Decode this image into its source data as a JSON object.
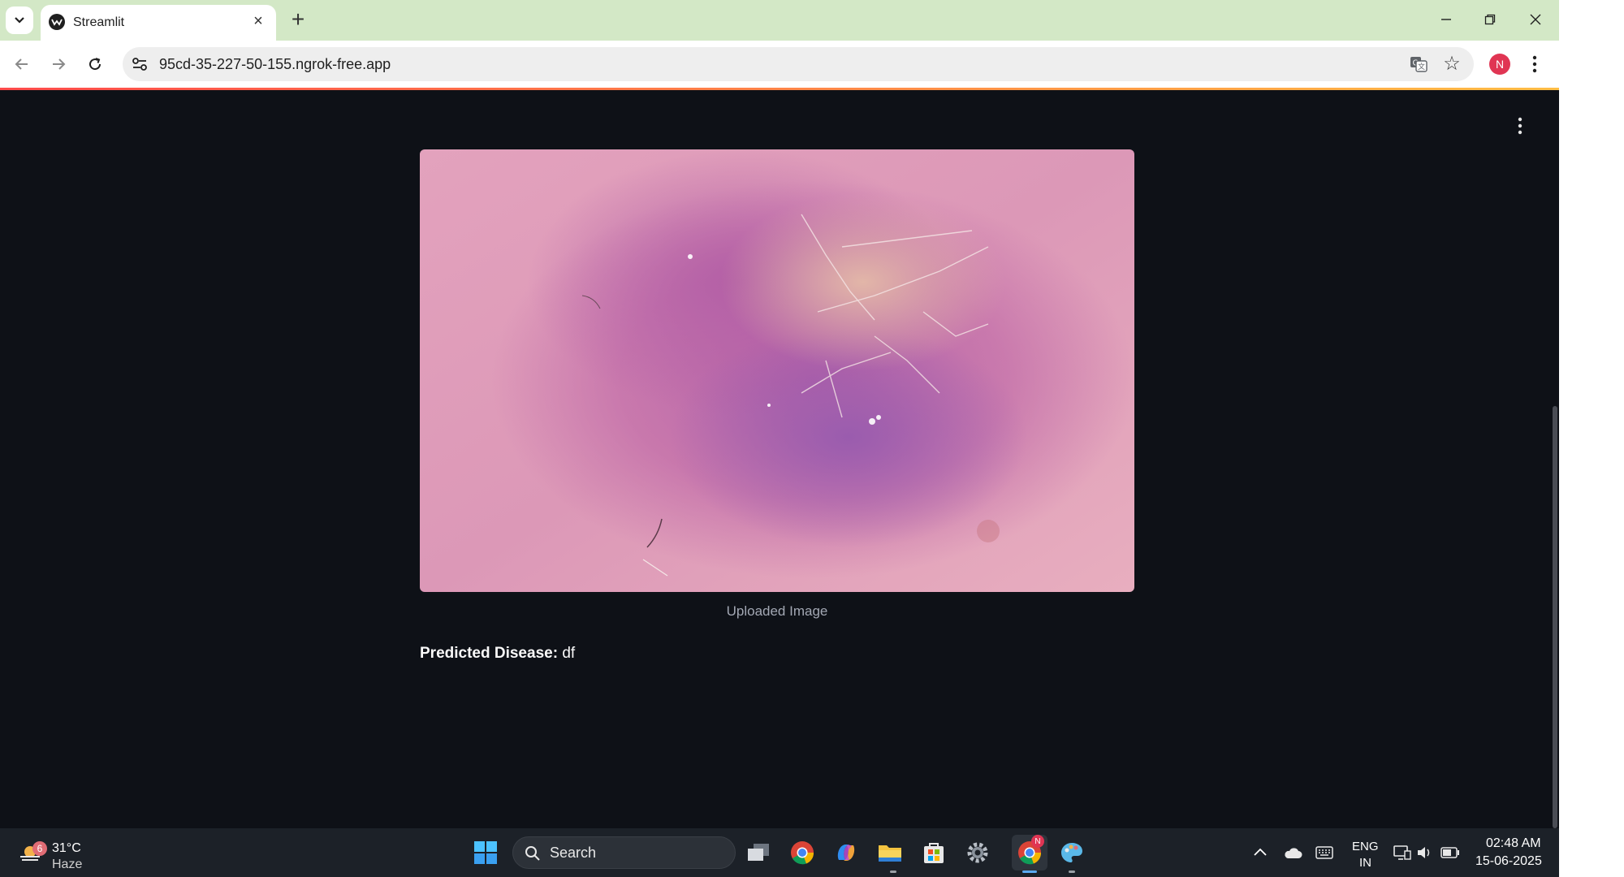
{
  "browser": {
    "tab_title": "Streamlit",
    "url": "95cd-35-227-50-155.ngrok-free.app",
    "profile_initial": "N"
  },
  "app": {
    "image_caption": "Uploaded Image",
    "prediction_label": "Predicted Disease:",
    "prediction_value": "df"
  },
  "taskbar": {
    "weather_badge": "6",
    "temperature": "31°C",
    "condition": "Haze",
    "search_placeholder": "Search",
    "chrome_badge": "N",
    "language_line1": "ENG",
    "language_line2": "IN",
    "time": "02:48 AM",
    "date": "15-06-2025"
  },
  "colors": {
    "app_background": "#0e1117",
    "tab_strip": "#d3e8c6",
    "accent_gradient_start": "#ff4b4b",
    "accent_gradient_end": "#ffbd45",
    "taskbar": "#1c2128"
  }
}
